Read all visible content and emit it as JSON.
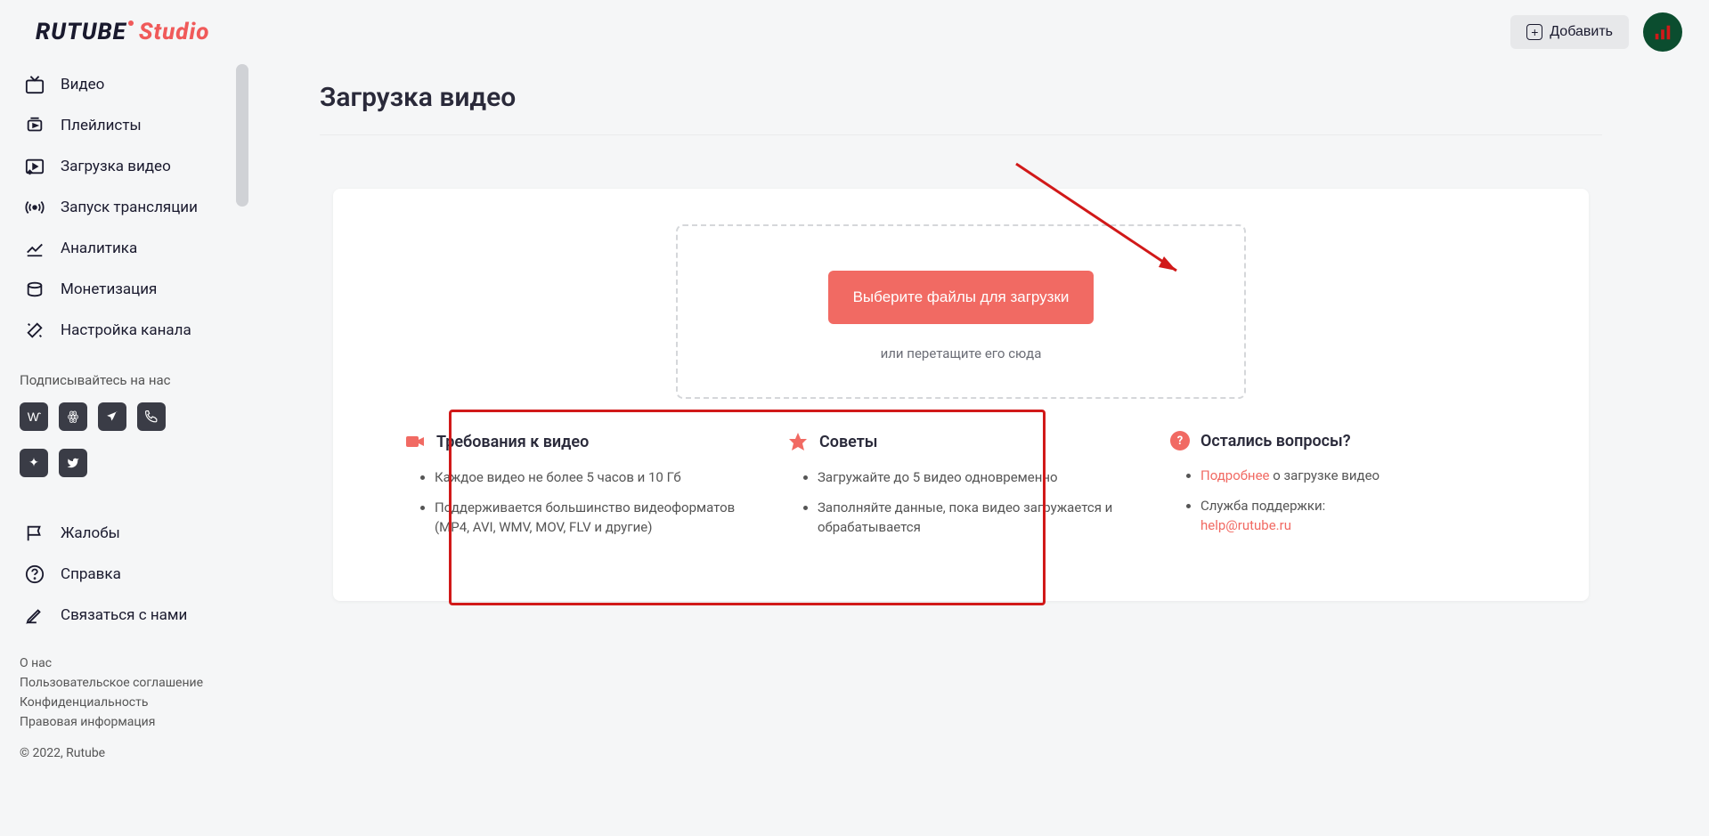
{
  "header": {
    "logo_black": "RUTUBE",
    "logo_red": "Studio",
    "add_label": "Добавить"
  },
  "sidebar": {
    "items": [
      {
        "label": "Видео"
      },
      {
        "label": "Плейлисты"
      },
      {
        "label": "Загрузка видео"
      },
      {
        "label": "Запуск трансляции"
      },
      {
        "label": "Аналитика"
      },
      {
        "label": "Монетизация"
      },
      {
        "label": "Настройка канала"
      }
    ],
    "subscribe_title": "Подписывайтесь на нас",
    "bottom": [
      {
        "label": "Жалобы"
      },
      {
        "label": "Справка"
      },
      {
        "label": "Связаться с нами"
      }
    ],
    "footer": [
      "О нас",
      "Пользовательское соглашение",
      "Конфиденциальность",
      "Правовая информация"
    ],
    "copyright": "© 2022, Rutube"
  },
  "main": {
    "title": "Загрузка видео",
    "upload_btn": "Выберите файлы для загрузки",
    "drop_hint": "или перетащите его сюда",
    "requirements": {
      "title": "Требования к видео",
      "items": [
        "Каждое видео не более 5 часов и 10 Гб",
        "Поддерживается большинство видеоформатов (MP4, AVI, WMV, MOV, FLV и другие)"
      ]
    },
    "tips": {
      "title": "Советы",
      "items": [
        "Загружайте до 5 видео одновременно",
        "Заполняйте данные, пока видео загружается и обрабатывается"
      ]
    },
    "questions": {
      "title": "Остались вопросы?",
      "more_link": "Подробнее",
      "more_text": " о загрузке видео",
      "support_label": "Служба поддержки:",
      "support_email": "help@rutube.ru"
    }
  }
}
